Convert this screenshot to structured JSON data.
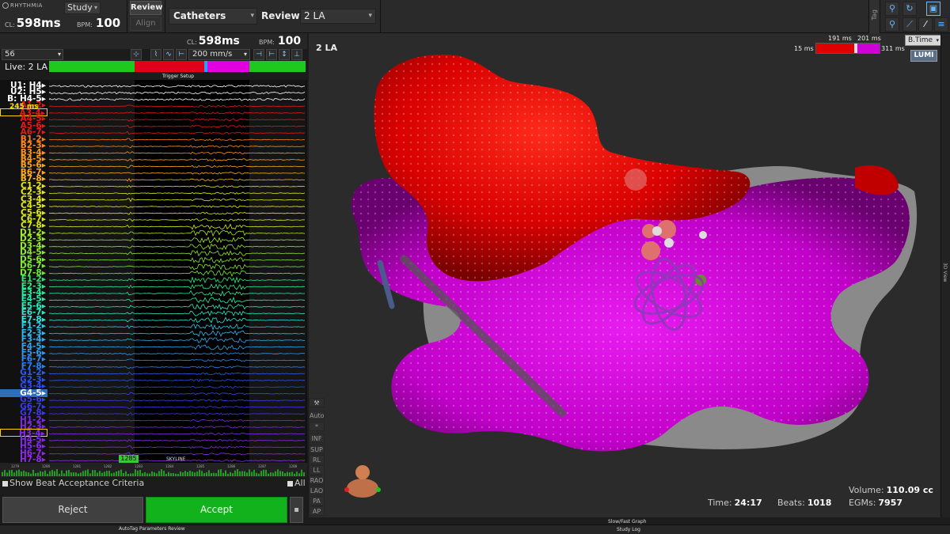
{
  "app": {
    "logo_text": "RHYTHMIA"
  },
  "topbar": {
    "cl_label": "CL:",
    "cl_value": "598ms",
    "bpm_label": "BPM:",
    "bpm_value": "100",
    "study_label": "Study",
    "review_button": "Review",
    "align_button": "Align",
    "catheters_label": "Catheters",
    "review_label": "Review:",
    "review_value": "2 LA",
    "tag_label": "Tag"
  },
  "egm_panel": {
    "cl_label": "CL:",
    "cl_value": "598ms",
    "bpm_label": "BPM:",
    "bpm_value": "100",
    "beat_number": "56",
    "speed": "200 mm/s",
    "live_label": "Live: 2 LA",
    "trigger_label": "Trigger Setup",
    "measure_label": "245 ms",
    "skyline_label": "SKYLINE",
    "beat_marker": "1285",
    "timeline_ticks": [
      "1279",
      "1280",
      "1281",
      "1282",
      "1283",
      "1284",
      "1285",
      "1286",
      "1287",
      "1288"
    ],
    "show_beat_acceptance": "Show Beat Acceptance Criteria",
    "all_label": "All",
    "reject_button": "Reject",
    "accept_button": "Accept",
    "autotag_label": "AutoTag Parameters Review",
    "channels": [
      {
        "name": "U1: H4",
        "color": "#ffffff"
      },
      {
        "name": "U2: H5",
        "color": "#ffffff"
      },
      {
        "name": "B: H4-5",
        "color": "#ffffff"
      },
      {
        "name": "A1-2",
        "color": "#e81818"
      },
      {
        "name": "A3-4",
        "color": "#e81818",
        "highlight": true
      },
      {
        "name": "A4-5",
        "color": "#e81818"
      },
      {
        "name": "A5-6",
        "color": "#e81818"
      },
      {
        "name": "A6-7",
        "color": "#e81818"
      },
      {
        "name": "B1-2",
        "color": "#ff7d12"
      },
      {
        "name": "B2-3",
        "color": "#ff8a14"
      },
      {
        "name": "B3-4",
        "color": "#ff9415"
      },
      {
        "name": "B4-5",
        "color": "#ff9c17"
      },
      {
        "name": "B5-6",
        "color": "#ffa318"
      },
      {
        "name": "B6-7",
        "color": "#ffab19"
      },
      {
        "name": "B7-8",
        "color": "#ffb51a"
      },
      {
        "name": "C1-2",
        "color": "#e8e81c"
      },
      {
        "name": "C2-3",
        "color": "#e6e81c"
      },
      {
        "name": "C3-4",
        "color": "#e4e81c"
      },
      {
        "name": "C4-5",
        "color": "#e0e81c"
      },
      {
        "name": "C5-6",
        "color": "#dce81c"
      },
      {
        "name": "C6-7",
        "color": "#d8e81c"
      },
      {
        "name": "C7-8",
        "color": "#d4e81c"
      },
      {
        "name": "D1-2",
        "color": "#a6e82a"
      },
      {
        "name": "D2-3",
        "color": "#9ee82c"
      },
      {
        "name": "D3-4",
        "color": "#96e82e"
      },
      {
        "name": "D4-5",
        "color": "#8ee830"
      },
      {
        "name": "D5-6",
        "color": "#86e832"
      },
      {
        "name": "D6-7",
        "color": "#7ee834"
      },
      {
        "name": "D7-8",
        "color": "#76e836"
      },
      {
        "name": "E1-2",
        "color": "#2ee87a"
      },
      {
        "name": "E2-3",
        "color": "#2ee88a"
      },
      {
        "name": "E3-4",
        "color": "#2ee89a"
      },
      {
        "name": "E4-5",
        "color": "#2ee8aa"
      },
      {
        "name": "E5-6",
        "color": "#2ee8ba"
      },
      {
        "name": "E6-7",
        "color": "#2ee8ca"
      },
      {
        "name": "E7-8",
        "color": "#2ee8da"
      },
      {
        "name": "F1-2",
        "color": "#2ec8f0"
      },
      {
        "name": "F2-3",
        "color": "#2ebcf0"
      },
      {
        "name": "F3-4",
        "color": "#2eb0f0"
      },
      {
        "name": "F4-5",
        "color": "#2ea4f0"
      },
      {
        "name": "F5-6",
        "color": "#2e98f0"
      },
      {
        "name": "F6-7",
        "color": "#2e8cf0"
      },
      {
        "name": "F7-8",
        "color": "#2e80f0"
      },
      {
        "name": "G1-2",
        "color": "#2e5cf0"
      },
      {
        "name": "G2-3",
        "color": "#2e52f0"
      },
      {
        "name": "G3-4",
        "color": "#2e48f0"
      },
      {
        "name": "G4-5",
        "color": "#ffffff",
        "selected": true
      },
      {
        "name": "G5-6",
        "color": "#3640f0"
      },
      {
        "name": "G6-7",
        "color": "#3a3af0"
      },
      {
        "name": "G7-8",
        "color": "#4036f0"
      },
      {
        "name": "H1-2",
        "color": "#7a2ae8"
      },
      {
        "name": "H2-3",
        "color": "#7e2ae8"
      },
      {
        "name": "H3-4",
        "color": "#822ae8",
        "highlight": true
      },
      {
        "name": "H4-5",
        "color": "#862ae8"
      },
      {
        "name": "H5-6",
        "color": "#8a2ae8"
      },
      {
        "name": "H6-7",
        "color": "#8e2ae8"
      },
      {
        "name": "H7-8",
        "color": "#922ae8"
      }
    ]
  },
  "map_view": {
    "view_name": "2 LA",
    "scale_min": "15 ms",
    "scale_low": "191 ms",
    "scale_high": "201 ms",
    "scale_max": "311 ms",
    "time_mode": "B.Time",
    "lumi_label": "LUMI",
    "side_label": "3D View",
    "view_tools": [
      "Auto",
      "*",
      "INF",
      "SUP",
      "RL",
      "LL",
      "RAO",
      "LAO",
      "PA",
      "AP"
    ],
    "time_label": "Time:",
    "time_value": "24:17",
    "beats_label": "Beats:",
    "beats_value": "1018",
    "egms_label": "EGMs:",
    "egms_value": "7957",
    "volume_label": "Volume:",
    "volume_value": "110.09 cc",
    "slow_fast_label": "Slow/Fast Graph",
    "study_log_label": "Study Log"
  },
  "colors": {
    "accept_green": "#12b21c",
    "map_red": "#e00000",
    "map_magenta": "#d000d8",
    "trigger_red": "#e0001a",
    "trigger_magenta": "#e000e0",
    "trigger_green": "#1ec81e"
  }
}
